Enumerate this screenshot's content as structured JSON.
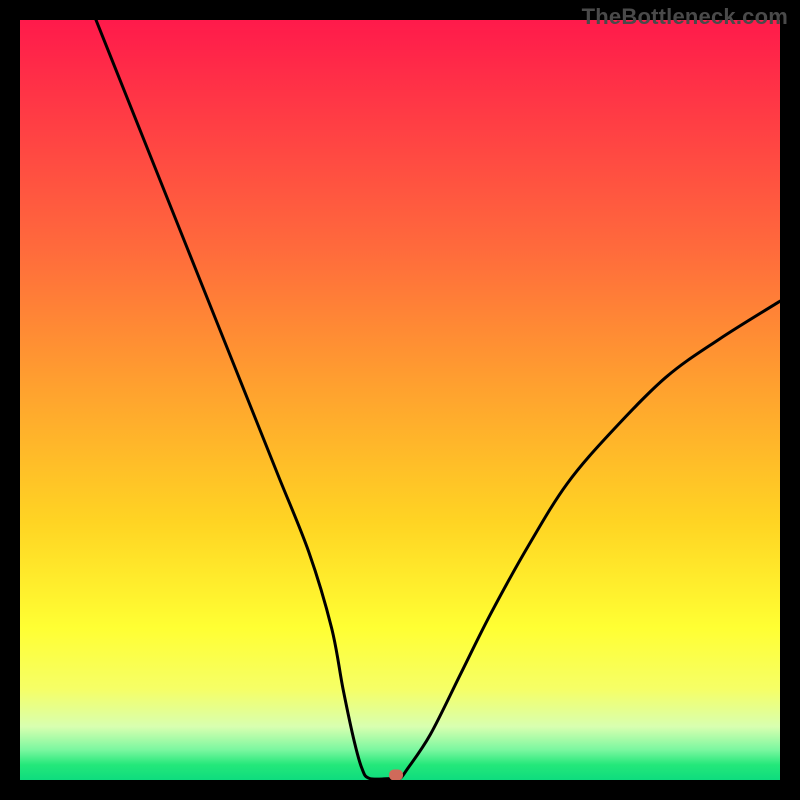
{
  "watermark": "TheBottleneck.com",
  "chart_data": {
    "type": "line",
    "title": "",
    "xlabel": "",
    "ylabel": "",
    "xlim": [
      0,
      100
    ],
    "ylim": [
      0,
      100
    ],
    "grid": false,
    "series": [
      {
        "name": "bottleneck-curve",
        "x": [
          10,
          14,
          18,
          22,
          26,
          30,
          34,
          38,
          41,
          42.5,
          44,
          45,
          46,
          49,
          50,
          51,
          54,
          58,
          62,
          67,
          72,
          78,
          85,
          92,
          100
        ],
        "y": [
          100,
          90,
          80,
          70,
          60,
          50,
          40,
          30,
          20,
          12,
          5,
          1.5,
          0.2,
          0.2,
          0.2,
          1.5,
          6,
          14,
          22,
          31,
          39,
          46,
          53,
          58,
          63
        ]
      }
    ],
    "marker": {
      "x": 49.5,
      "y": 0.6,
      "color": "#d06a5a"
    },
    "gradient_stops": [
      {
        "pct": 0,
        "color": "#ff1a4b"
      },
      {
        "pct": 12,
        "color": "#ff3a45"
      },
      {
        "pct": 30,
        "color": "#ff6a3c"
      },
      {
        "pct": 48,
        "color": "#ffa02f"
      },
      {
        "pct": 66,
        "color": "#ffd423"
      },
      {
        "pct": 80,
        "color": "#ffff33"
      },
      {
        "pct": 88,
        "color": "#f6ff66"
      },
      {
        "pct": 93,
        "color": "#d8ffb0"
      },
      {
        "pct": 96,
        "color": "#7cf7a0"
      },
      {
        "pct": 98,
        "color": "#24e87a"
      },
      {
        "pct": 100,
        "color": "#0edc7e"
      }
    ]
  }
}
